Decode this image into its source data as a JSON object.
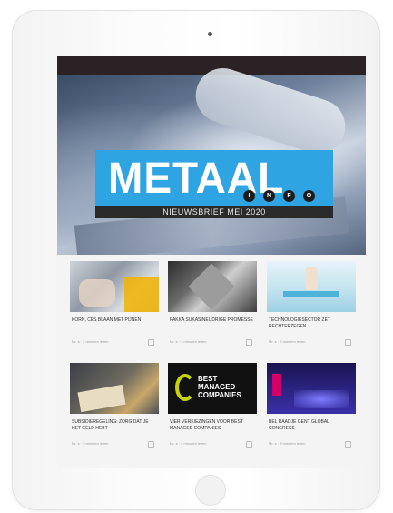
{
  "hero": {
    "logo_text": "METAAL",
    "logo_dots": [
      "I",
      "N",
      "F",
      "O"
    ],
    "subtitle": "NIEUWSBRIEF MEI 2020"
  },
  "cards": [
    {
      "title": "Korn, ces blaan met pijnen",
      "meta": "Mr. s · 2 minuten lezen",
      "thumb_icon": "workshop-photo"
    },
    {
      "title": "Pakka sukasineudrige promesse",
      "meta": "Mr. s · 3 minuten lezen",
      "thumb_icon": "metal-parts-photo"
    },
    {
      "title": "Technologiesector zet rechterzegen",
      "meta": "Mr. s · 2 minuten lezen",
      "thumb_icon": "illustration-banner"
    },
    {
      "title": "Subsidieregeling: zorg dat je het geld hebt",
      "meta": "Mr. s · 3 minuten lezen",
      "thumb_icon": "paperwork-photo"
    },
    {
      "title": "Vier verkiezingen voor best managed companies",
      "meta": "Mr. s · 2 minuten lezen",
      "thumb_icon": "best-managed-companies-logo"
    },
    {
      "title": "Bel raadje Gent global congress",
      "meta": "Mr. s · 3 minuten lezen",
      "thumb_icon": "event-stage-photo"
    }
  ],
  "bmc_logo": "BEST MANAGED COMPANIES",
  "colors": {
    "brand": "#2ea4e3",
    "topbar": "#2a2224",
    "bmc_accent": "#c7d400"
  }
}
